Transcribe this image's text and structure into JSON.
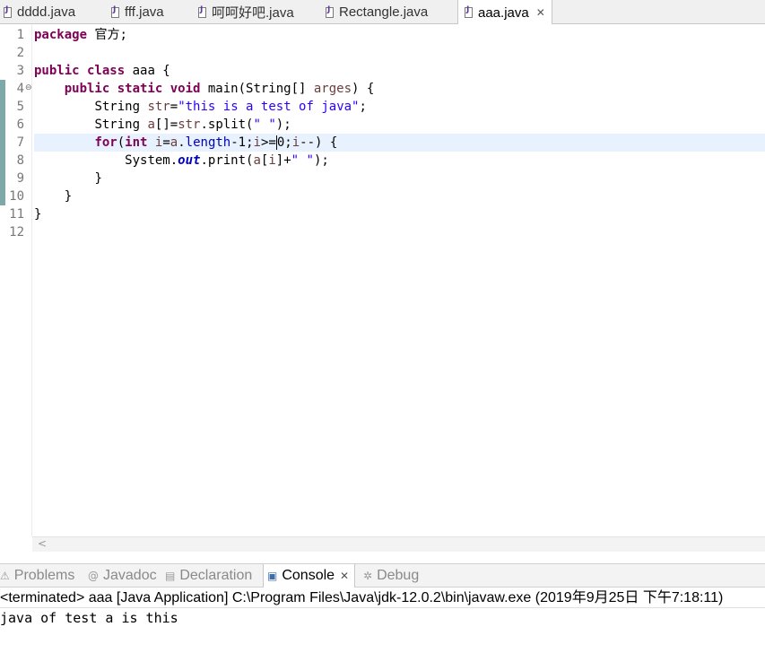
{
  "editor_tabs": [
    {
      "label": "dddd.java",
      "active": false
    },
    {
      "label": "fff.java",
      "active": false
    },
    {
      "label": "呵呵好吧.java",
      "active": false
    },
    {
      "label": "Rectangle.java",
      "active": false
    },
    {
      "label": "aaa.java",
      "active": true
    }
  ],
  "tab_close_glyph": "✕",
  "line_numbers": [
    "1",
    "2",
    "3",
    "4",
    "5",
    "6",
    "7",
    "8",
    "9",
    "10",
    "11",
    "12"
  ],
  "code": {
    "l1_kw": "package",
    "l1_rest": " 官方;",
    "l3_kw": "public class",
    "l3_rest": " aaa {",
    "l4_kw": "public static void",
    "l4_rest1": " main(String[] ",
    "l4_var": "arges",
    "l4_rest2": ") {",
    "l5_rest1": "String ",
    "l5_var": "str",
    "l5_eq": "=",
    "l5_str": "\"this is a test of java\"",
    "l5_end": ";",
    "l6_rest1": "String ",
    "l6_var": "a",
    "l6_rest2": "[]=",
    "l6_var2": "str",
    "l6_rest3": ".split(",
    "l6_str": "\" \"",
    "l6_end": ");",
    "l7_kw1": "for",
    "l7_p": "(",
    "l7_kw2": "int",
    "l7_sp": " ",
    "l7_var1": "i",
    "l7_eq": "=",
    "l7_var2": "a",
    "l7_dot": ".",
    "l7_field": "length",
    "l7_m1": "-1;",
    "l7_var3": "i",
    "l7_cmp": ">=",
    "l7_zero": "0",
    "l7_semi": ";",
    "l7_var4": "i",
    "l7_end": "--) {",
    "l8_sys": "System.",
    "l8_field": "out",
    "l8_print": ".print(",
    "l8_var": "a",
    "l8_br": "[",
    "l8_var2": "i",
    "l8_plus": "]+",
    "l8_str": "\" \"",
    "l8_end": ");",
    "l9": "}",
    "l10": "}",
    "l11": "}"
  },
  "scroll_left_glyph": "<",
  "bottom_tabs": [
    {
      "label": "Problems",
      "icon": "problems-icon",
      "glyph": "⚠",
      "active": false
    },
    {
      "label": "Javadoc",
      "icon": "javadoc-icon",
      "glyph": "@",
      "active": false
    },
    {
      "label": "Declaration",
      "icon": "declaration-icon",
      "glyph": "▤",
      "active": false
    },
    {
      "label": "Console",
      "icon": "console-icon",
      "glyph": "▣",
      "active": true
    },
    {
      "label": "Debug",
      "icon": "debug-icon",
      "glyph": "✲",
      "active": false
    }
  ],
  "console": {
    "status": "<terminated> aaa [Java Application] C:\\Program Files\\Java\\jdk-12.0.2\\bin\\javaw.exe (2019年9月25日 下午7:18:11)",
    "output": "java of test a is this"
  },
  "colors": {
    "keyword": "#7f0055",
    "string": "#2a00ff",
    "variable": "#6a3e3e",
    "field": "#0000c0",
    "current_line": "#e8f2fe"
  }
}
